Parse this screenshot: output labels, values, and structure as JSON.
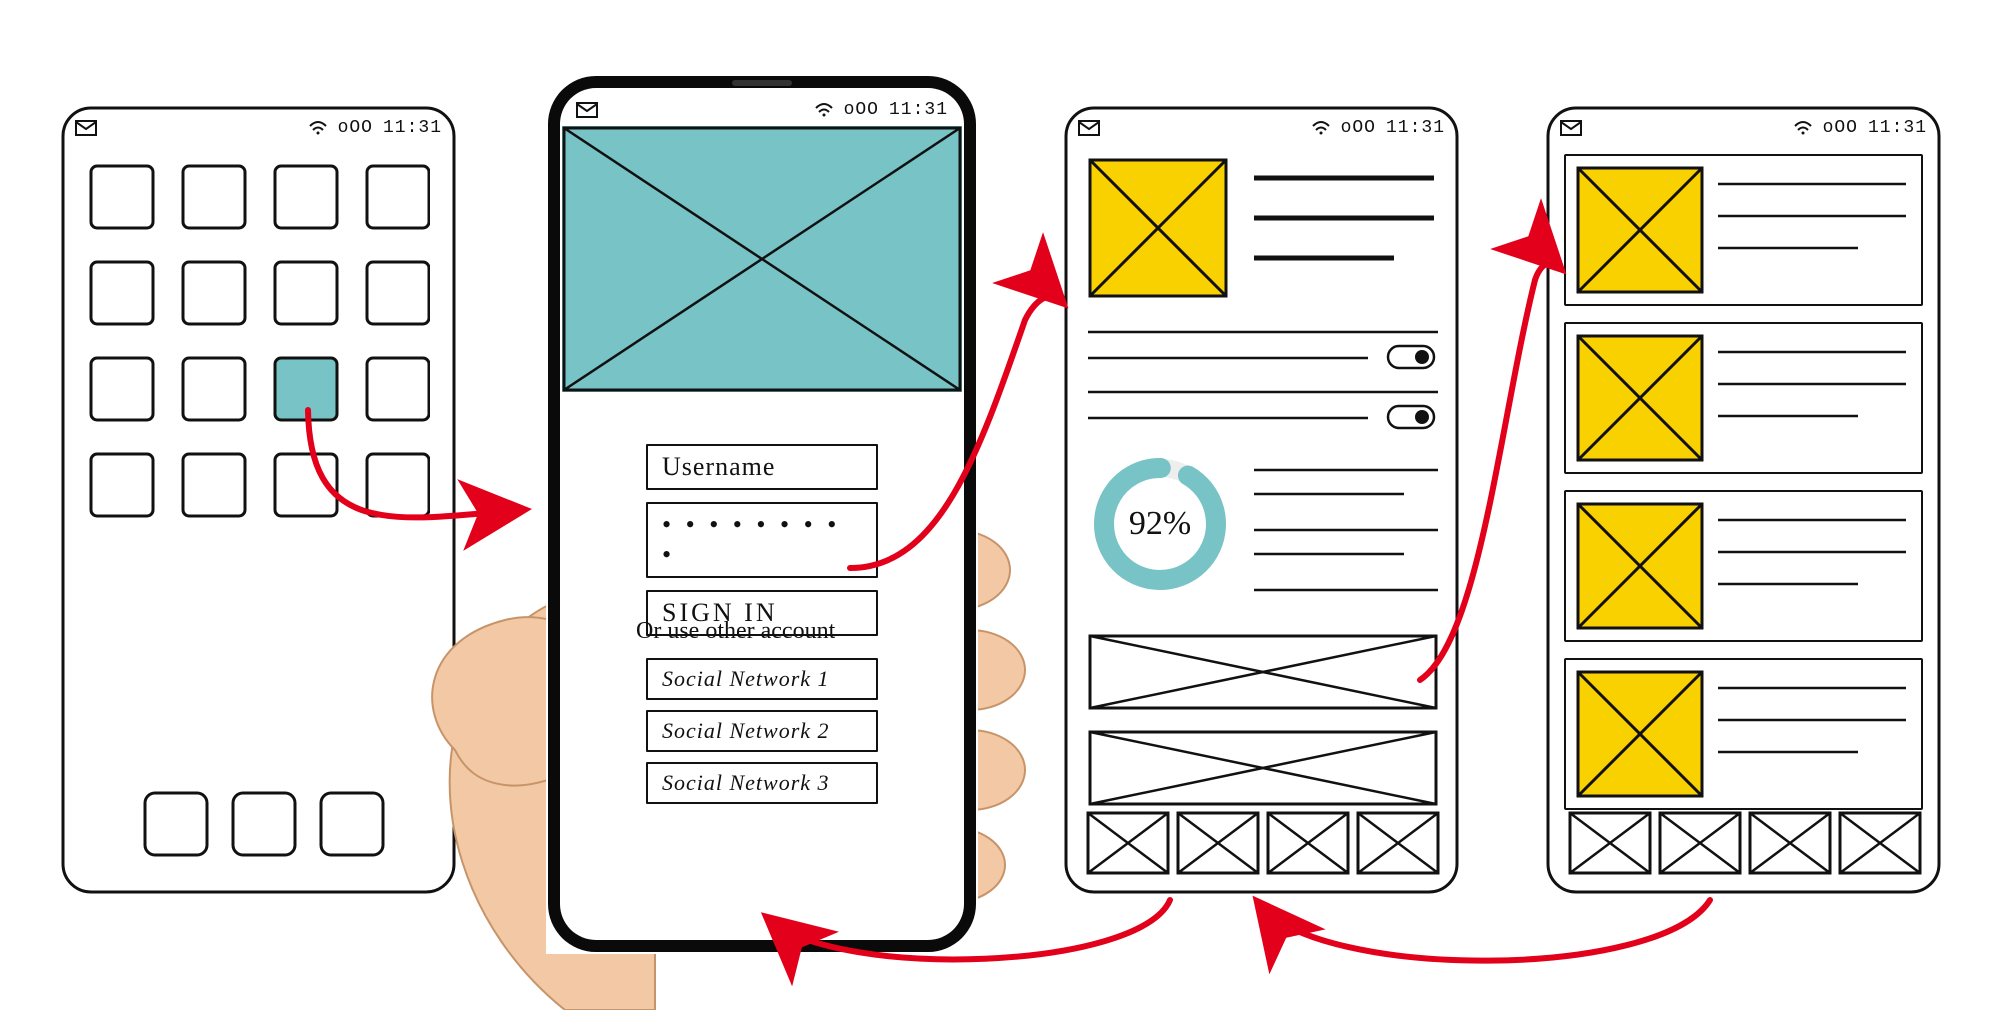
{
  "statusbar": {
    "time": "11:31",
    "signal_text": "oOO",
    "wifi_icon": "wifi-icon",
    "mail_icon": "mail-icon"
  },
  "colors": {
    "teal": "#78C3C6",
    "yellow": "#FAD100",
    "arrow": "#E2001A",
    "ink": "#111111"
  },
  "screen1": {
    "grid_rows": 4,
    "grid_cols": 4,
    "highlighted_row": 2,
    "highlighted_col": 2,
    "dock_count": 3
  },
  "screen2": {
    "username_label": "Username",
    "password_mask": "• • • • • • • • •",
    "signin_label": "SIGN IN",
    "alt_label": "Or use other account",
    "social": [
      "Social Network 1",
      "Social Network 2",
      "Social Network 3"
    ]
  },
  "screen3": {
    "progress_text": "92%",
    "progress_value": 92,
    "header_lines": 3,
    "toggles": [
      true,
      true
    ],
    "body_line_groups": [
      2,
      2,
      2,
      2
    ],
    "banner_count": 2,
    "nav_count": 4
  },
  "screen4": {
    "cards": 4,
    "lines_per_card": 3,
    "nav_count": 4
  }
}
